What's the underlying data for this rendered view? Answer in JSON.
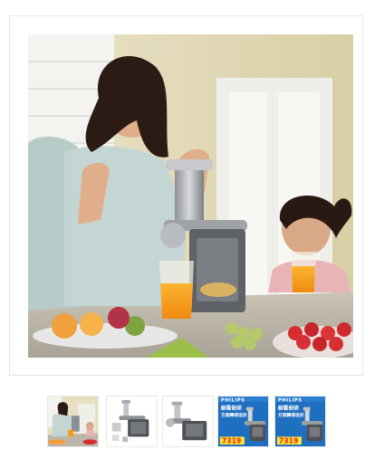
{
  "gallery": {
    "main_image_alt": "",
    "thumbnails": [
      {
        "kind": "lifestyle",
        "selected": true
      },
      {
        "kind": "product-with-accessories",
        "selected": false
      },
      {
        "kind": "product-side",
        "selected": false
      },
      {
        "kind": "promo",
        "brand": "PHILIPS",
        "headline": "細看冊研",
        "subline": "方案轉得信計",
        "price": "7319",
        "selected": false
      },
      {
        "kind": "promo",
        "brand": "PHILIPS",
        "headline": "細看冊研",
        "subline": "方案轉得信計",
        "price": "7319",
        "selected": false
      }
    ]
  },
  "colors": {
    "frame_border": "#e6e6e6",
    "thumb_border": "#e8e8e8",
    "promo_blue": "#1f6fc1",
    "price_red": "#e8231d"
  }
}
